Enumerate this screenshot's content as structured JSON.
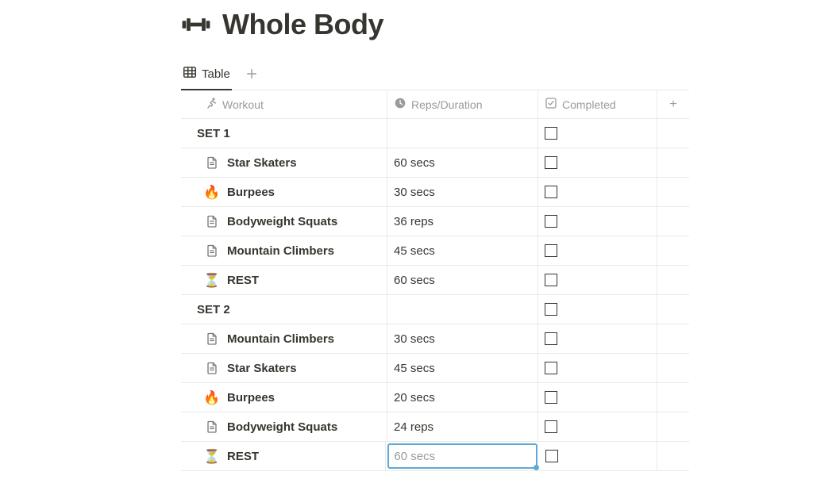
{
  "page": {
    "title": "Whole Body",
    "icon": "dumbbell-icon"
  },
  "tabs": {
    "active_label": "Table"
  },
  "columns": {
    "workout": "Workout",
    "reps": "Reps/Duration",
    "completed": "Completed"
  },
  "rows": [
    {
      "type": "set",
      "icon": "",
      "name": "SET 1",
      "reps": "",
      "completed": false
    },
    {
      "type": "item",
      "icon": "page",
      "name": "Star Skaters",
      "reps": "60 secs",
      "completed": false
    },
    {
      "type": "item",
      "icon": "fire",
      "name": "Burpees",
      "reps": "30 secs",
      "completed": false
    },
    {
      "type": "item",
      "icon": "page",
      "name": "Bodyweight Squats",
      "reps": "36 reps",
      "completed": false
    },
    {
      "type": "item",
      "icon": "page",
      "name": "Mountain Climbers",
      "reps": "45 secs",
      "completed": false
    },
    {
      "type": "item",
      "icon": "hourglass",
      "name": "REST",
      "reps": "60 secs",
      "completed": false
    },
    {
      "type": "set",
      "icon": "",
      "name": "SET 2",
      "reps": "",
      "completed": false
    },
    {
      "type": "item",
      "icon": "page",
      "name": "Mountain Climbers",
      "reps": "30 secs",
      "completed": false
    },
    {
      "type": "item",
      "icon": "page",
      "name": "Star Skaters",
      "reps": "45 secs",
      "completed": false
    },
    {
      "type": "item",
      "icon": "fire",
      "name": "Burpees",
      "reps": "20 secs",
      "completed": false
    },
    {
      "type": "item",
      "icon": "page",
      "name": "Bodyweight Squats",
      "reps": "24 reps",
      "completed": false
    },
    {
      "type": "item",
      "icon": "hourglass",
      "name": "REST",
      "reps": "60 secs",
      "completed": false,
      "editing": true
    }
  ]
}
